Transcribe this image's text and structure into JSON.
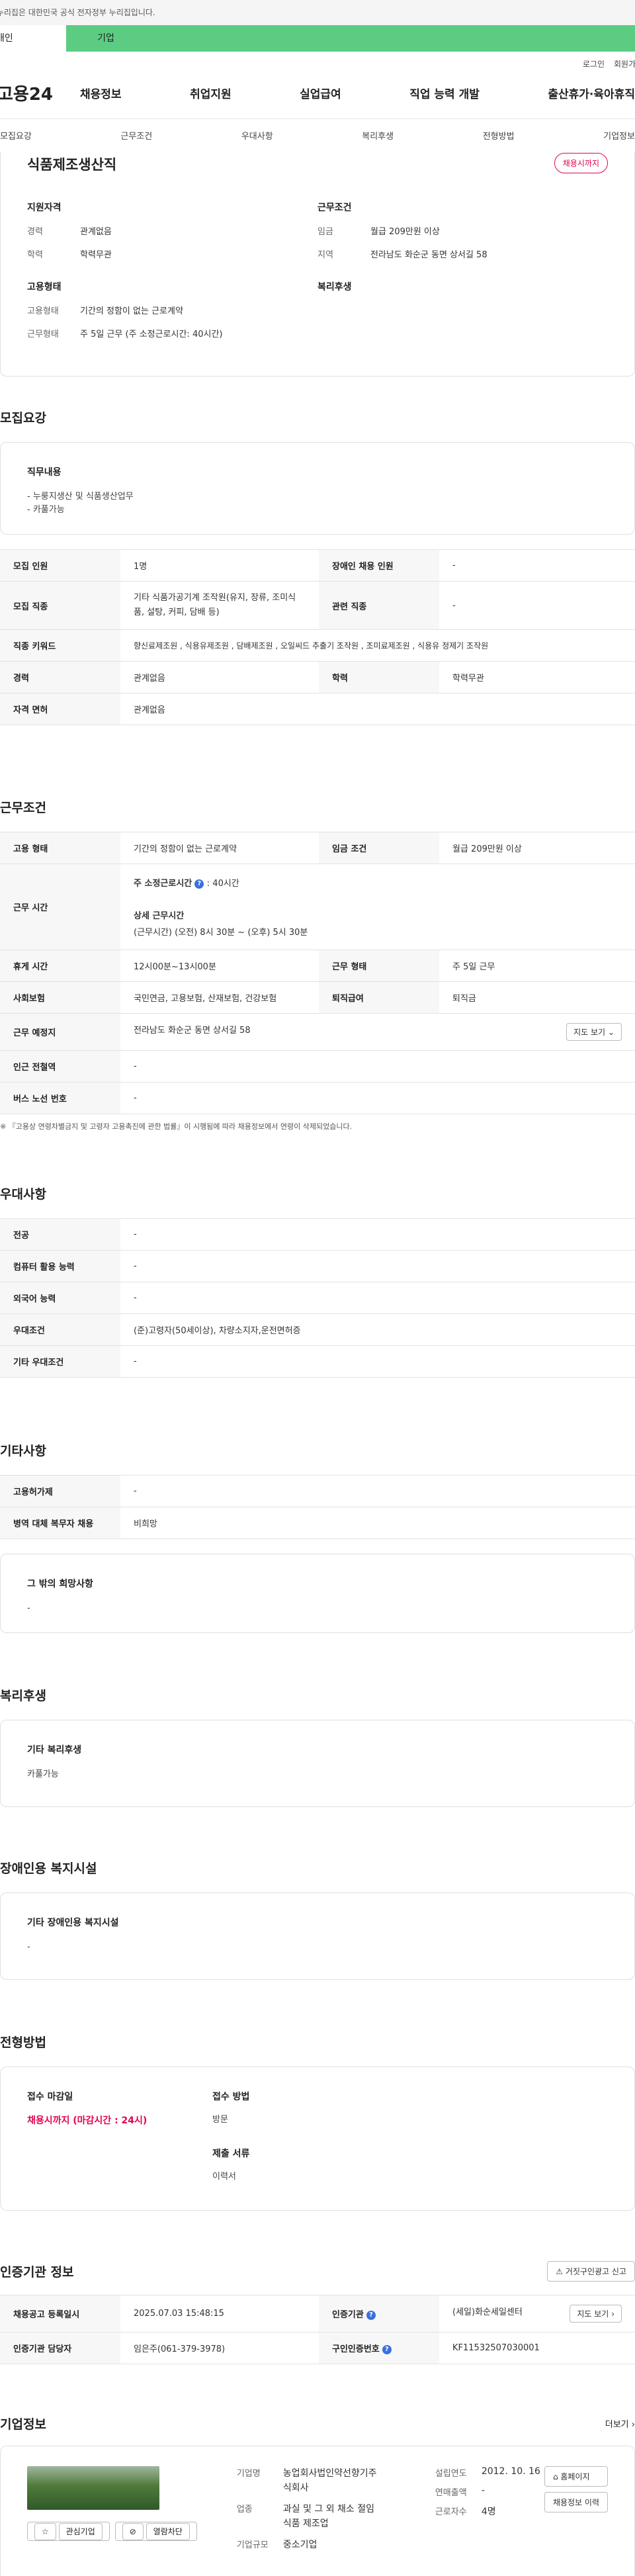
{
  "gov_banner": "이 누리집은 대한민국 공식 전자정부 누리집입니다.",
  "topbar": {
    "tab_person": "개인",
    "tab_company": "기업"
  },
  "util": [
    "로그인",
    "회원가입"
  ],
  "logo": "고용24",
  "gnb": [
    "채용정보",
    "취업지원",
    "실업급여",
    "직업 능력 개발",
    "출산휴가·육아휴직"
  ],
  "subnav": [
    "모집요강",
    "근무조건",
    "우대사항",
    "복리후생",
    "전형방법",
    "기업정보"
  ],
  "job": {
    "title": "식품제조생산직",
    "status": "채용시까지",
    "qual_title": "지원자격",
    "cond_title": "근무조건",
    "career_k": "경력",
    "career_v": "관계없음",
    "edu_k": "학력",
    "edu_v": "학력무관",
    "wage_k": "임금",
    "wage_v": "월급 209만원 이상",
    "region_k": "지역",
    "region_v": "전라남도 화순군 동면 상서길 58",
    "emp_title": "고용형태",
    "welfare_title": "복리후생",
    "emptype_k": "고용형태",
    "emptype_v": "기간의 정함이 없는 근로계약",
    "worktype_k": "근무형태",
    "worktype_v": "주 5일 근무 (주 소정근로시간: 40시간)"
  },
  "recruit": {
    "heading": "모집요강",
    "duty_title": "직무내용",
    "duty_lines": [
      "- 누룽지생산 및 식품생산업무",
      "- 카풀가능"
    ],
    "rows": {
      "count_k": "모집 인원",
      "count_v": "1명",
      "disab_k": "장애인 채용 인원",
      "disab_v": "-",
      "job_k": "모집 직종",
      "job_v": "기타 식품가공기계 조작원(유지, 장류, 조미식품, 설탕, 커피, 담배 등)",
      "rel_k": "관련 직종",
      "rel_v": "-",
      "kw_k": "직종 키워드",
      "kw_v": "향신료제조원 , 식용유제조원 , 담배제조원 , 오일씨드 추출기 조작원 , 조미료제조원 , 식용유 정제기 조작원",
      "career_k": "경력",
      "career_v": "관계없음",
      "edu_k": "학력",
      "edu_v": "학력무관",
      "license_k": "자격 면허",
      "license_v": "관계없음"
    }
  },
  "work": {
    "heading": "근무조건",
    "emp_k": "고용 형태",
    "emp_v": "기간의 정함이 없는 근로계약",
    "wage_k": "임금 조건",
    "wage_v": "월급 209만원 이상",
    "time_k": "근무 시간",
    "time_main_label": "주 소정근로시간",
    "time_main_value": ": 40시간",
    "time_detail_label": "상세 근무시간",
    "time_detail_value": "(근무시간) (오전) 8시 30분 ~ (오후) 5시 30분",
    "rest_k": "휴게 시간",
    "rest_v": "12시00분~13시00분",
    "form_k": "근무 형태",
    "form_v": "주 5일 근무",
    "ins_k": "사회보험",
    "ins_v": "국민연금, 고용보험, 산재보험, 건강보험",
    "sev_k": "퇴직급여",
    "sev_v": "퇴직금",
    "place_k": "근무 예정지",
    "place_v": "전라남도 화순군 동면 상서길 58",
    "map_btn": "지도 보기",
    "subway_k": "인근 전철역",
    "subway_v": "-",
    "bus_k": "버스 노선 번호",
    "bus_v": "-",
    "note": "※ 『고용상 연령차별금지 및 고령자 고용촉진에 관한 법률』이 시행됨에 따라 채용정보에서 연령이 삭제되었습니다."
  },
  "pref": {
    "heading": "우대사항",
    "major_k": "전공",
    "major_v": "-",
    "pc_k": "컴퓨터 활용 능력",
    "pc_v": "-",
    "lang_k": "외국어 능력",
    "lang_v": "-",
    "cond_k": "우대조건",
    "cond_v": "(준)고령자(50세이상), 차량소지자,운전면허증",
    "etc_k": "기타 우대조건",
    "etc_v": "-"
  },
  "other": {
    "heading": "기타사항",
    "hire_k": "고용허가제",
    "hire_v": "-",
    "mil_k": "병역 대체 복무자 채용",
    "mil_v": "비희망",
    "wish_title": "그 밖의 희망사항",
    "wish_v": "-"
  },
  "welfare": {
    "heading": "복리후생",
    "title": "기타 복리후생",
    "value": "카풀가능"
  },
  "disab": {
    "heading": "장애인용 복지시설",
    "title": "기타 장애인용 복지시설",
    "value": "-"
  },
  "select": {
    "heading": "전형방법",
    "deadline_label": "접수 마감일",
    "deadline_value": "채용시까지 (마감시간 : 24시)",
    "method_label": "접수 방법",
    "method_value": "방문",
    "docs_label": "제출 서류",
    "docs_value": "이력서"
  },
  "cert": {
    "heading": "인증기관 정보",
    "report_btn": "거짓구인광고 신고",
    "reg_k": "채용공고 등록일시",
    "reg_v": "2025.07.03 15:48:15",
    "org_k": "인증기관",
    "org_v": "(세일)화순세일센터",
    "map_btn": "지도 보기",
    "staff_k": "인증기관 담당자",
    "staff_v": "임은주(061-379-3978)",
    "no_k": "구인인증번호",
    "no_v": "KF11532507030001"
  },
  "company": {
    "heading": "기업정보",
    "more": "더보기",
    "fav_btn": "관심기업",
    "block_btn": "열람차단",
    "name_k": "기업명",
    "name_v": "농업회사법인약선향기주식회사",
    "ind_k": "업종",
    "ind_v": "과실 및 그 외 채소 절임식품 제조업",
    "size_k": "기업규모",
    "size_v": "중소기업",
    "est_k": "설립연도",
    "est_v": "2012. 10. 16",
    "sales_k": "연매출액",
    "sales_v": "-",
    "staff_k": "근로자수",
    "staff_v": "4명",
    "home_btn": "홈페이지",
    "history_btn": "채용정보 이력"
  }
}
